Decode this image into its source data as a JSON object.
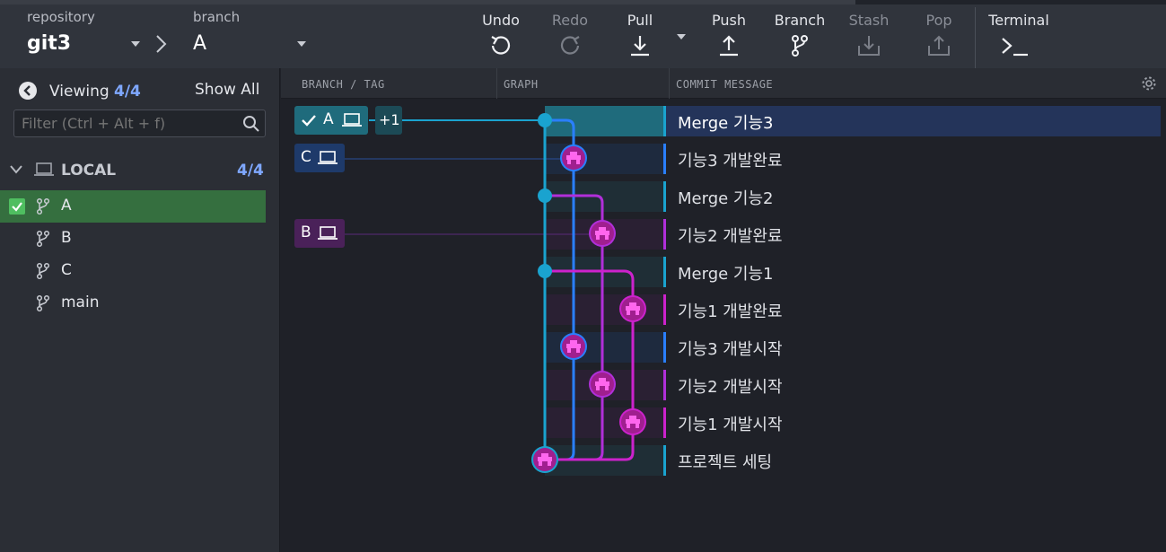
{
  "toolbar": {
    "repository_label": "repository",
    "repository_value": "git3",
    "branch_label": "branch",
    "branch_value": "A",
    "undo": "Undo",
    "redo": "Redo",
    "pull": "Pull",
    "push": "Push",
    "branch": "Branch",
    "stash": "Stash",
    "pop": "Pop",
    "terminal": "Terminal"
  },
  "sidebar": {
    "viewing_label": "Viewing",
    "viewing_count": "4/4",
    "show_all": "Show All",
    "filter_placeholder": "Filter (Ctrl + Alt + f)",
    "local_label": "LOCAL",
    "local_count": "4/4",
    "branches": [
      {
        "name": "A",
        "checked_out": true
      },
      {
        "name": "B",
        "checked_out": false
      },
      {
        "name": "C",
        "checked_out": false
      },
      {
        "name": "main",
        "checked_out": false
      }
    ]
  },
  "graph_header": {
    "branch_tag": "BRANCH / TAG",
    "graph": "GRAPH",
    "commit_message": "COMMIT MESSAGE"
  },
  "refs": {
    "a_label": "A",
    "plus_label": "+1",
    "c_label": "C",
    "b_label": "B"
  },
  "commits": [
    {
      "message": "Merge 기능3",
      "selected": true
    },
    {
      "message": "기능3 개발완료"
    },
    {
      "message": "Merge 기능2"
    },
    {
      "message": "기능2 개발완료"
    },
    {
      "message": "Merge 기능1"
    },
    {
      "message": "기능1 개발완료"
    },
    {
      "message": "기능3 개발시작"
    },
    {
      "message": "기능2 개발시작"
    },
    {
      "message": "기능1 개발시작"
    },
    {
      "message": "프로젝트 세팅"
    }
  ],
  "colors": {
    "lane_main": "#1aa3cf",
    "lane_blue": "#2a7fff",
    "lane_purple": "#b12fd9",
    "lane_magenta": "#cc22cc",
    "selected_row": "#24345a",
    "branch_a_active": "#356f3f"
  }
}
